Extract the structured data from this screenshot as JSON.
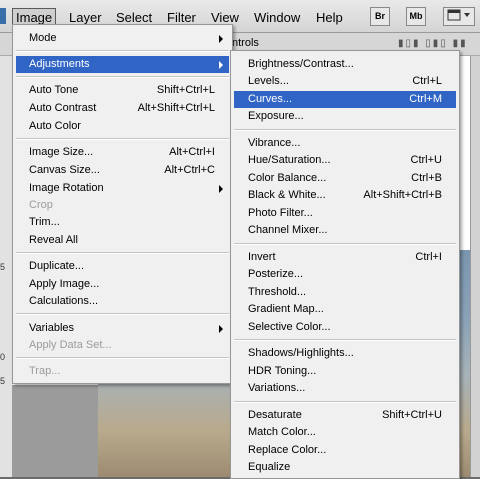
{
  "menubar": {
    "items": [
      {
        "label": "Image",
        "active": true
      },
      {
        "label": "Layer"
      },
      {
        "label": "Select"
      },
      {
        "label": "Filter"
      },
      {
        "label": "View"
      },
      {
        "label": "Window"
      },
      {
        "label": "Help"
      }
    ],
    "buttons": [
      "Br",
      "Mb"
    ]
  },
  "optbar": {
    "text": "ntrols"
  },
  "image_menu": [
    {
      "label": "Mode",
      "submenu": true
    },
    {
      "label": "Adjustments",
      "submenu": true,
      "highlighted": true
    },
    {
      "label": "Auto Tone",
      "shortcut": "Shift+Ctrl+L"
    },
    {
      "label": "Auto Contrast",
      "shortcut": "Alt+Shift+Ctrl+L"
    },
    {
      "label": "Auto Color"
    },
    {
      "label": "Image Size...",
      "shortcut": "Alt+Ctrl+I"
    },
    {
      "label": "Canvas Size...",
      "shortcut": "Alt+Ctrl+C"
    },
    {
      "label": "Image Rotation",
      "submenu": true
    },
    {
      "label": "Crop",
      "disabled": true
    },
    {
      "label": "Trim..."
    },
    {
      "label": "Reveal All"
    },
    {
      "label": "Duplicate..."
    },
    {
      "label": "Apply Image..."
    },
    {
      "label": "Calculations..."
    },
    {
      "label": "Variables",
      "submenu": true
    },
    {
      "label": "Apply Data Set...",
      "disabled": true
    },
    {
      "label": "Trap...",
      "disabled": true
    }
  ],
  "adjustments_menu": [
    {
      "label": "Brightness/Contrast..."
    },
    {
      "label": "Levels...",
      "shortcut": "Ctrl+L"
    },
    {
      "label": "Curves...",
      "shortcut": "Ctrl+M",
      "highlighted": true
    },
    {
      "label": "Exposure..."
    },
    {
      "label": "Vibrance..."
    },
    {
      "label": "Hue/Saturation...",
      "shortcut": "Ctrl+U"
    },
    {
      "label": "Color Balance...",
      "shortcut": "Ctrl+B"
    },
    {
      "label": "Black & White...",
      "shortcut": "Alt+Shift+Ctrl+B"
    },
    {
      "label": "Photo Filter..."
    },
    {
      "label": "Channel Mixer..."
    },
    {
      "label": "Invert",
      "shortcut": "Ctrl+I"
    },
    {
      "label": "Posterize..."
    },
    {
      "label": "Threshold..."
    },
    {
      "label": "Gradient Map..."
    },
    {
      "label": "Selective Color..."
    },
    {
      "label": "Shadows/Highlights..."
    },
    {
      "label": "HDR Toning..."
    },
    {
      "label": "Variations..."
    },
    {
      "label": "Desaturate",
      "shortcut": "Shift+Ctrl+U"
    },
    {
      "label": "Match Color..."
    },
    {
      "label": "Replace Color..."
    },
    {
      "label": "Equalize"
    }
  ],
  "ruler_marks": [
    "5",
    "0",
    "5"
  ],
  "colors": {
    "highlight": "#3165c5",
    "disabled": "#9b9b9b"
  }
}
